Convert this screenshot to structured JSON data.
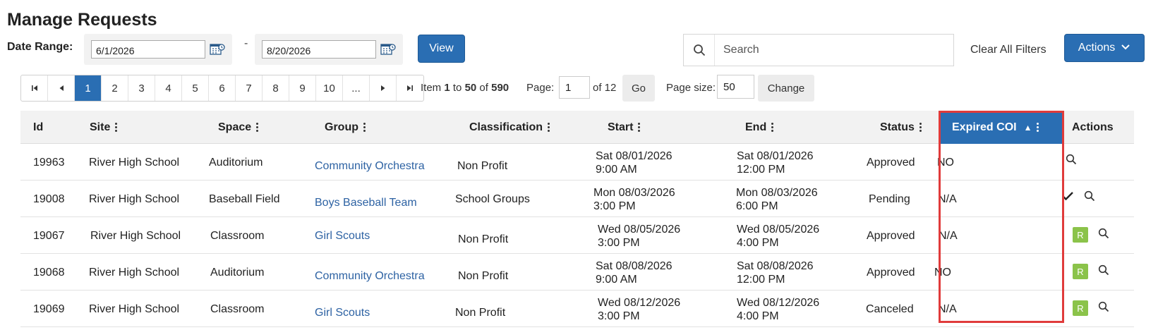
{
  "page": {
    "title": "Manage Requests"
  },
  "filters": {
    "date_range_label": "Date Range:",
    "start_date": "6/1/2026",
    "separator": "-",
    "end_date": "8/20/2026",
    "view_label": "View",
    "search_placeholder": "Search",
    "clear_label": "Clear All Filters",
    "actions_label": "Actions"
  },
  "pager": {
    "pages": [
      "1",
      "2",
      "3",
      "4",
      "5",
      "6",
      "7",
      "8",
      "9",
      "10",
      "..."
    ],
    "active_page": "1",
    "item_prefix": "Item",
    "item_from": "1",
    "item_to_word": "to",
    "item_to": "50",
    "item_of_word": "of",
    "item_total": "590",
    "page_label": "Page:",
    "page_value": "1",
    "of_pages": "of 12",
    "go_label": "Go",
    "page_size_label": "Page size:",
    "page_size_value": "50",
    "change_label": "Change"
  },
  "table": {
    "columns": {
      "id": "Id",
      "site": "Site",
      "space": "Space",
      "group": "Group",
      "classification": "Classification",
      "start": "Start",
      "end": "End",
      "status": "Status",
      "expired_coi": "Expired COI",
      "actions": "Actions"
    },
    "rows": [
      {
        "id": "19963",
        "site": "River High School",
        "space": "Auditorium",
        "group": "Community Orchestra",
        "classification": "Non Profit",
        "start_date": "Sat 08/01/2026",
        "start_time": "9:00 AM",
        "end_date": "Sat 08/01/2026",
        "end_time": "12:00 PM",
        "status": "Approved",
        "expired_coi": "NO",
        "actions": [
          "view"
        ]
      },
      {
        "id": "19008",
        "site": "River High School",
        "space": "Baseball Field",
        "group": "Boys Baseball Team",
        "classification": "School Groups",
        "start_date": "Mon 08/03/2026",
        "start_time": "3:00 PM",
        "end_date": "Mon 08/03/2026",
        "end_time": "6:00 PM",
        "status": "Pending",
        "expired_coi": "N/A",
        "actions": [
          "approve",
          "view"
        ]
      },
      {
        "id": "19067",
        "site": "River High School",
        "space": "Classroom",
        "group": "Girl Scouts",
        "classification": "Non Profit",
        "start_date": "Wed 08/05/2026",
        "start_time": "3:00 PM",
        "end_date": "Wed 08/05/2026",
        "end_time": "4:00 PM",
        "status": "Approved",
        "expired_coi": "N/A",
        "actions": [
          "R",
          "view"
        ]
      },
      {
        "id": "19068",
        "site": "River High School",
        "space": "Auditorium",
        "group": "Community Orchestra",
        "classification": "Non Profit",
        "start_date": "Sat 08/08/2026",
        "start_time": "9:00 AM",
        "end_date": "Sat 08/08/2026",
        "end_time": "12:00 PM",
        "status": "Approved",
        "expired_coi": "NO",
        "actions": [
          "R",
          "view"
        ]
      },
      {
        "id": "19069",
        "site": "River High School",
        "space": "Classroom",
        "group": "Girl Scouts",
        "classification": "Non Profit",
        "start_date": "Wed 08/12/2026",
        "start_time": "3:00 PM",
        "end_date": "Wed 08/12/2026",
        "end_time": "4:00 PM",
        "status": "Canceled",
        "expired_coi": "N/A",
        "actions": [
          "R",
          "view"
        ]
      }
    ]
  },
  "colors": {
    "primary": "#2a6eb3",
    "link": "#2d62a3",
    "badge_green": "#8bc34a",
    "highlight": "#e03b3b"
  }
}
